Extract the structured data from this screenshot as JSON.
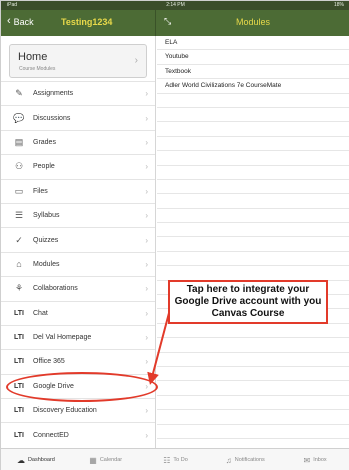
{
  "status": {
    "device": "iPad",
    "time": "2:14 PM",
    "battery": "18%"
  },
  "nav": {
    "back_label": "Back",
    "course_title": "Testing1234",
    "modules_title": "Modules"
  },
  "home": {
    "title": "Home",
    "subtitle": "Course Modules"
  },
  "menu": [
    {
      "label": "Assignments",
      "icon": "assignments-icon"
    },
    {
      "label": "Discussions",
      "icon": "discussions-icon"
    },
    {
      "label": "Grades",
      "icon": "grades-icon"
    },
    {
      "label": "People",
      "icon": "people-icon"
    },
    {
      "label": "Files",
      "icon": "folder-icon"
    },
    {
      "label": "Syllabus",
      "icon": "syllabus-icon"
    },
    {
      "label": "Quizzes",
      "icon": "quizzes-icon"
    },
    {
      "label": "Modules",
      "icon": "modules-icon"
    },
    {
      "label": "Collaborations",
      "icon": "collaborations-icon"
    },
    {
      "label": "Chat",
      "icon": "lti-icon",
      "lti": "LTI"
    },
    {
      "label": "Del Val Homepage",
      "icon": "lti-icon",
      "lti": "LTI"
    },
    {
      "label": "Office 365",
      "icon": "lti-icon",
      "lti": "LTI"
    },
    {
      "label": "Google Drive",
      "icon": "lti-icon",
      "lti": "LTI"
    },
    {
      "label": "Discovery Education",
      "icon": "lti-icon",
      "lti": "LTI"
    },
    {
      "label": "ConnectED",
      "icon": "lti-icon",
      "lti": "LTI"
    }
  ],
  "modules": [
    "ELA",
    "Youtube",
    "Textbook",
    "Adler World Civilizations 7e CourseMate"
  ],
  "callout": {
    "text": "Tap here to integrate your Google Drive account with you Canvas Course"
  },
  "tabs": [
    {
      "label": "Dashboard",
      "icon": "dashboard-icon",
      "active": true
    },
    {
      "label": "Calendar",
      "icon": "calendar-icon"
    },
    {
      "label": "To Do",
      "icon": "todo-icon"
    },
    {
      "label": "Notifications",
      "icon": "bell-icon"
    },
    {
      "label": "Inbox",
      "icon": "inbox-icon"
    }
  ],
  "colors": {
    "nav_bg": "#4c6b35",
    "accent_yellow": "#e8d94a",
    "annotation_red": "#e23a2a"
  }
}
